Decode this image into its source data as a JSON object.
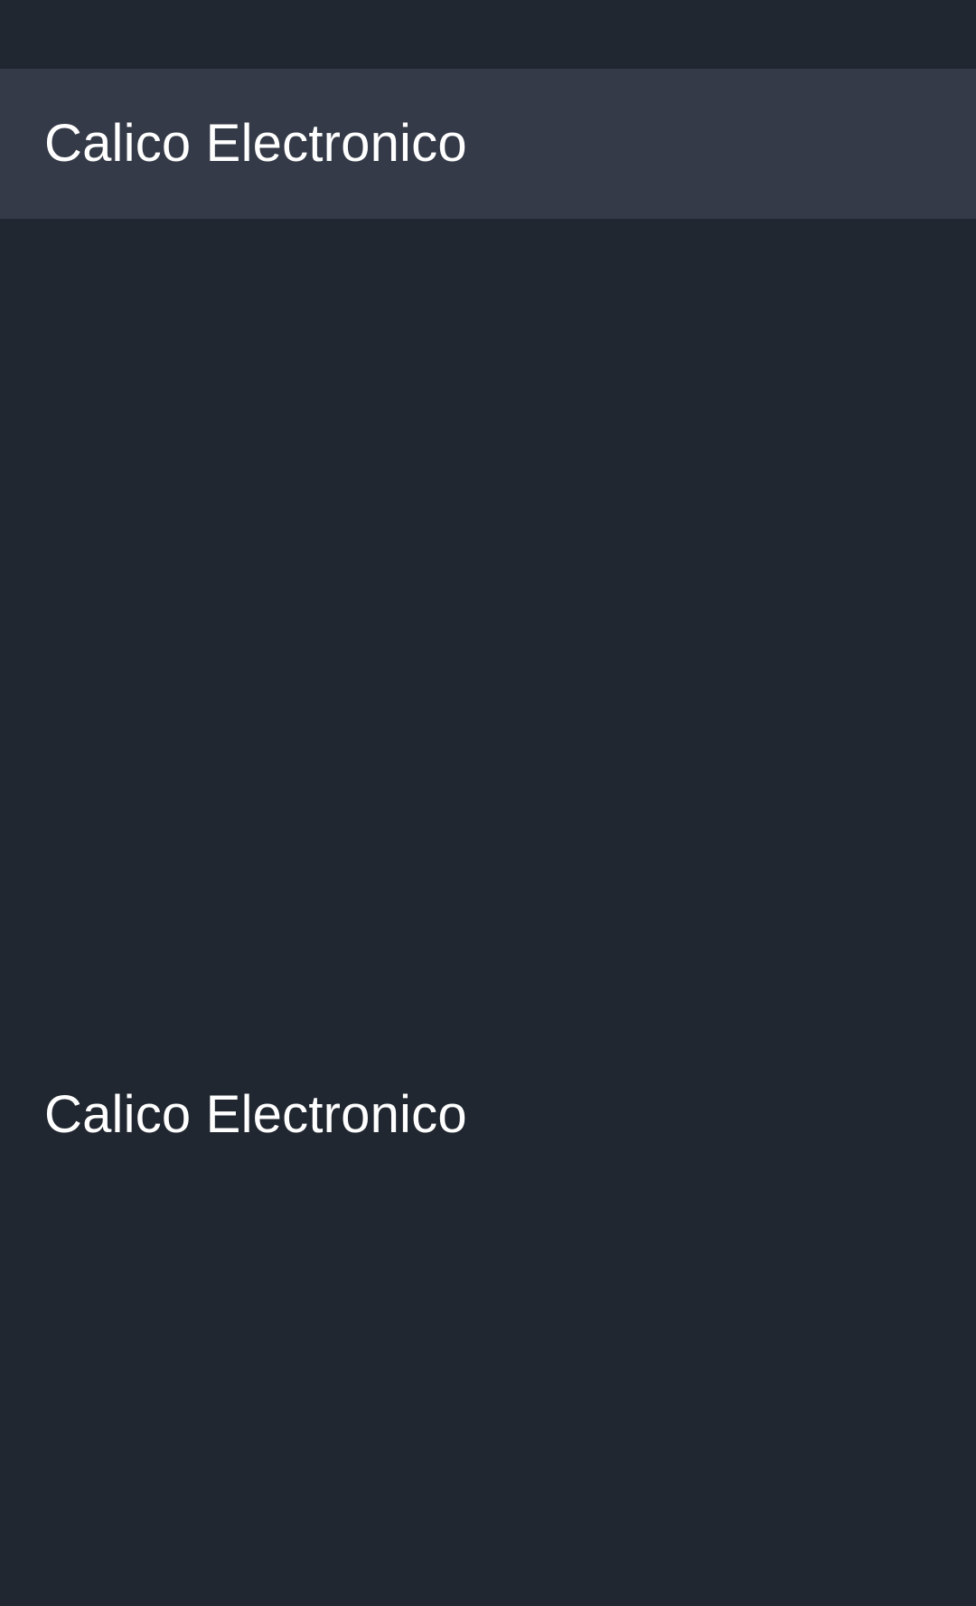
{
  "app_bar": {
    "title": "Calico Electronico"
  },
  "content": {
    "title": "Calico Electronico"
  }
}
